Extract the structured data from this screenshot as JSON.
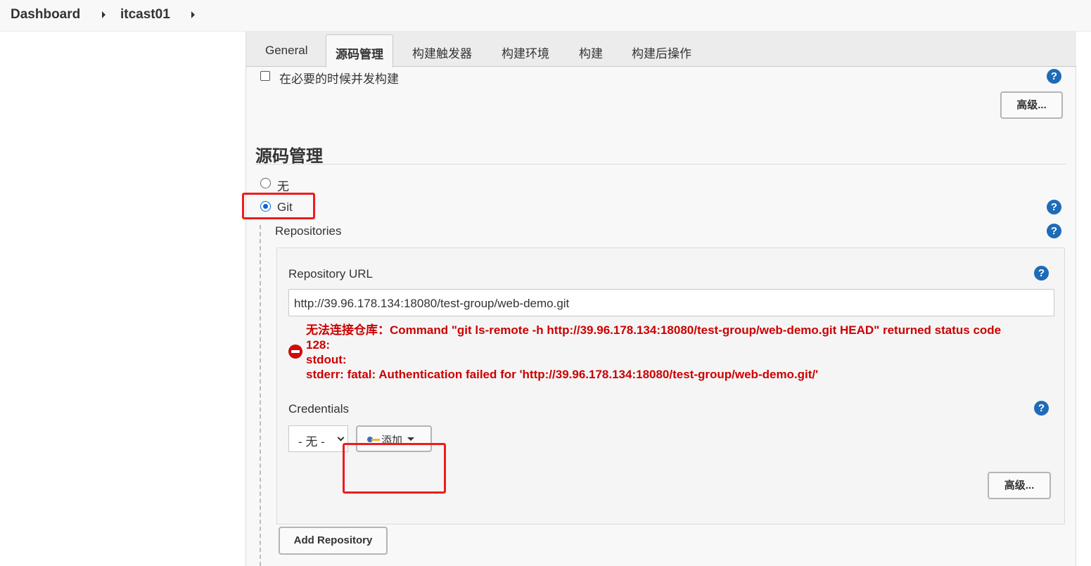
{
  "breadcrumb": {
    "items": [
      "Dashboard",
      "itcast01"
    ]
  },
  "tabs": [
    "General",
    "源码管理",
    "构建触发器",
    "构建环境",
    "构建",
    "构建后操作"
  ],
  "active_tab": "源码管理",
  "options": {
    "concurrent_build_label": "在必要的时候并发构建",
    "concurrent_build_checked": false,
    "advanced_label": "高级..."
  },
  "scm": {
    "section_title": "源码管理",
    "none_label": "无",
    "git_label": "Git",
    "selected": "Git",
    "repositories_label": "Repositories",
    "repository_url_label": "Repository URL",
    "repository_url_value": "http://39.96.178.134:18080/test-group/web-demo.git",
    "error_lines": [
      "无法连接仓库：Command \"git ls-remote -h http://39.96.178.134:18080/test-group/web-demo.git HEAD\" returned status code",
      "128:",
      "stdout:",
      "stderr: fatal: Authentication failed for 'http://39.96.178.134:18080/test-group/web-demo.git/'"
    ],
    "credentials_label": "Credentials",
    "credentials_selected": "- 无 -",
    "add_button_label": "添加",
    "repo_advanced_label": "高级...",
    "add_repository_label": "Add Repository"
  },
  "help_glyph": "?",
  "colors": {
    "error": "#cc0000",
    "help": "#1e6bb8",
    "highlight": "#ee1c1c",
    "radio_checked": "#0a66d8"
  }
}
